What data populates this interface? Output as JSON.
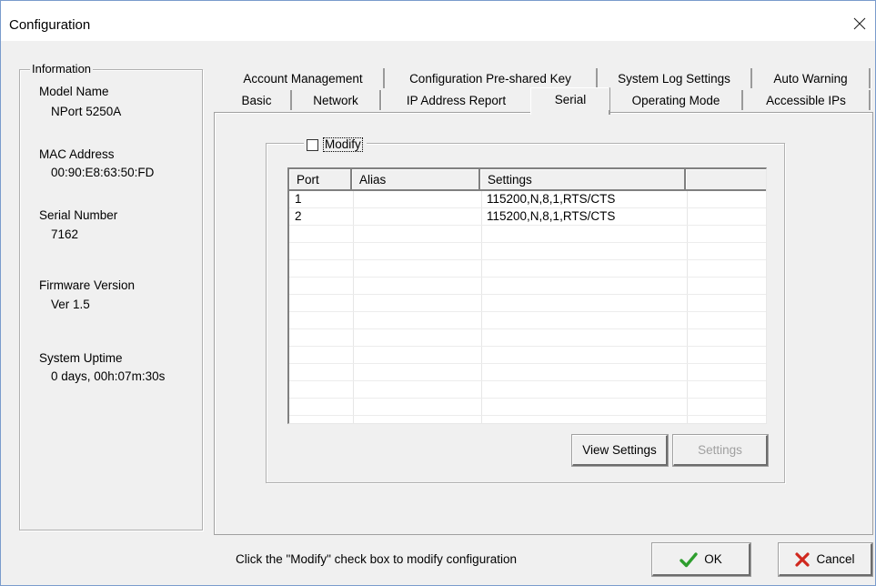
{
  "window": {
    "title": "Configuration"
  },
  "info": {
    "legend": "Information",
    "fields": [
      {
        "label": "Model Name",
        "value": "NPort 5250A"
      },
      {
        "label": "MAC Address",
        "value": "00:90:E8:63:50:FD"
      },
      {
        "label": "Serial Number",
        "value": "7162"
      },
      {
        "label": "Firmware Version",
        "value": "Ver 1.5"
      },
      {
        "label": "System Uptime",
        "value": "0 days, 00h:07m:30s"
      }
    ]
  },
  "tabs": {
    "row1": [
      "Account Management",
      "Configuration Pre-shared Key",
      "System Log Settings",
      "Auto Warning"
    ],
    "row2": [
      "Basic",
      "Network",
      "IP Address Report",
      "Serial",
      "Operating Mode",
      "Accessible IPs"
    ],
    "active": "Serial"
  },
  "serial": {
    "modify_label": "Modify",
    "modify_checked": false,
    "columns": [
      "Port",
      "Alias",
      "Settings",
      ""
    ],
    "rows": [
      {
        "port": "1",
        "alias": "",
        "settings": "115200,N,8,1,RTS/CTS"
      },
      {
        "port": "2",
        "alias": "",
        "settings": "115200,N,8,1,RTS/CTS"
      }
    ],
    "view_settings_label": "View Settings",
    "settings_label": "Settings"
  },
  "footer": {
    "hint": "Click the \"Modify\" check box to modify configuration",
    "ok_label": "OK",
    "cancel_label": "Cancel"
  },
  "colors": {
    "ok_check": "#2e9e2e",
    "cancel_x": "#d0281e",
    "window_border": "#7a9ccc"
  }
}
